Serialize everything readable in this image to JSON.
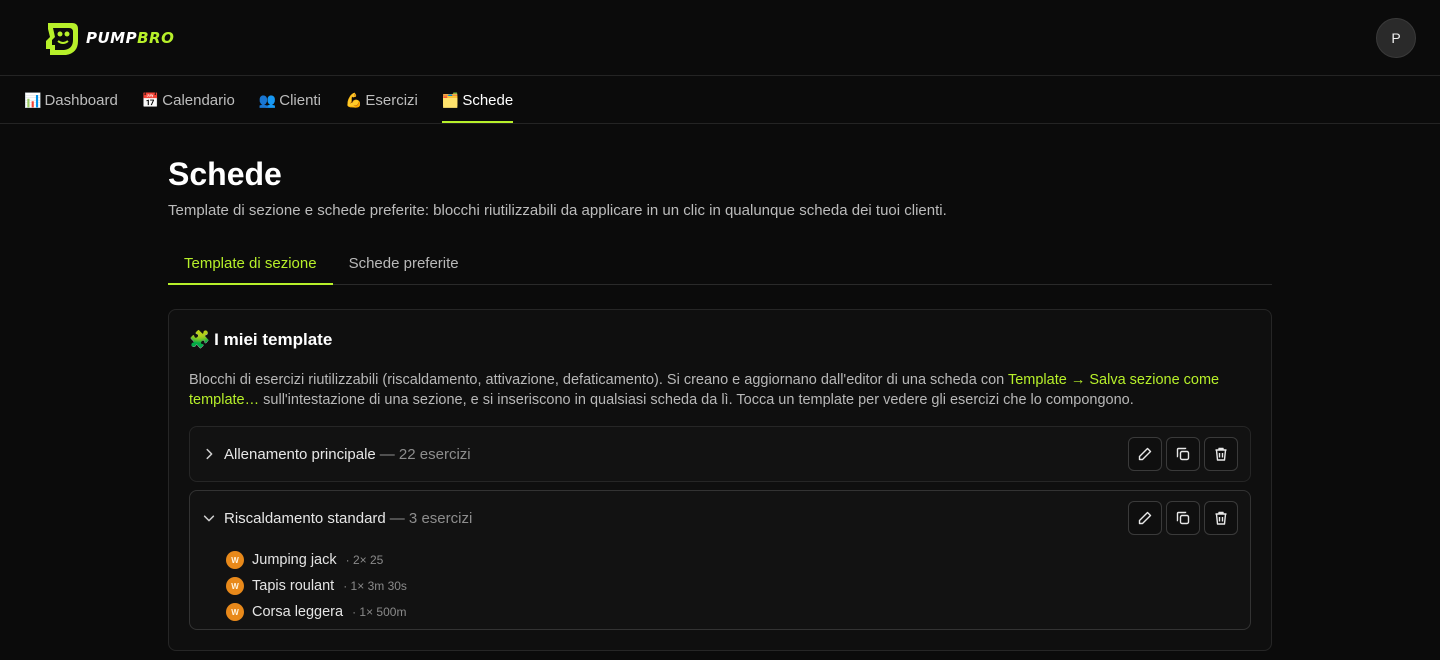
{
  "brand": {
    "name_part1": "PUMP",
    "name_part2": "BRO",
    "accent_color": "#b7f02a"
  },
  "user": {
    "avatar_initial": "P"
  },
  "nav": [
    {
      "emoji": "📊",
      "label": "Dashboard"
    },
    {
      "emoji": "📅",
      "label": "Calendario"
    },
    {
      "emoji": "👥",
      "label": "Clienti"
    },
    {
      "emoji": "💪",
      "label": "Esercizi"
    },
    {
      "emoji": "🗂️",
      "label": "Schede",
      "active": true
    }
  ],
  "page": {
    "title": "Schede",
    "subtitle": "Template di sezione e schede preferite: blocchi riutilizzabili da applicare in un clic in qualunque scheda dei tuoi clienti."
  },
  "tabs": [
    {
      "label": "Template di sezione",
      "active": true
    },
    {
      "label": "Schede preferite",
      "active": false
    }
  ],
  "card": {
    "emoji": "🧩",
    "title": "I miei template",
    "desc_before": "Blocchi di esercizi riutilizzabili (riscaldamento, attivazione, defaticamento). Si creano e aggiornano dall'editor di una scheda con ",
    "desc_highlight": "Template → Salva sezione come template…",
    "desc_after": " sull'intestazione di una sezione, e si inseriscono in qualsiasi scheda da lì. Tocca un template per vedere gli esercizi che lo compongono."
  },
  "templates": [
    {
      "name": "Allenamento principale",
      "count": "— 22 esercizi",
      "expanded": false
    },
    {
      "name": "Riscaldamento standard",
      "count": "— 3 esercizi",
      "expanded": true,
      "exercises": [
        {
          "badge": "W",
          "name": "Jumping jack",
          "detail": "· 2× 25"
        },
        {
          "badge": "W",
          "name": "Tapis roulant",
          "detail": "· 1× 3m 30s"
        },
        {
          "badge": "W",
          "name": "Corsa leggera",
          "detail": "· 1× 500m"
        }
      ]
    }
  ],
  "icons": {
    "edit": "pencil-icon",
    "duplicate": "copy-icon",
    "delete": "trash-icon",
    "collapsed": "chevron-right-icon",
    "expanded": "chevron-down-icon"
  }
}
